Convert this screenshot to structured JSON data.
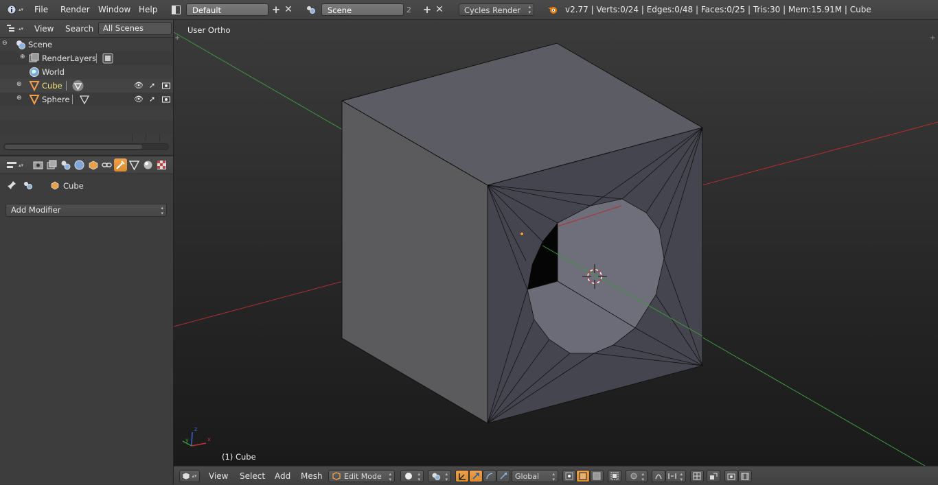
{
  "topbar": {
    "menus": [
      "File",
      "Render",
      "Window",
      "Help"
    ],
    "layout_name": "Default",
    "scene_name": "Scene",
    "scene_users": "2",
    "render_engine": "Cycles Render",
    "stats": "v2.77 | Verts:0/24 | Edges:0/48 | Faces:0/25 | Tris:30 | Mem:15.91M | Cube"
  },
  "outliner": {
    "header": {
      "view": "View",
      "search": "Search",
      "filter": "All Scenes"
    },
    "items": [
      {
        "label": "Scene"
      },
      {
        "label": "RenderLayers"
      },
      {
        "label": "World"
      },
      {
        "label": "Cube"
      },
      {
        "label": "Sphere"
      }
    ]
  },
  "properties": {
    "object_name": "Cube",
    "add_modifier": "Add Modifier"
  },
  "viewport": {
    "view_label": "User Ortho",
    "object_label": "(1) Cube",
    "axis_x": "x",
    "axis_y": "y",
    "axis_z": "z"
  },
  "bottombar": {
    "menus": [
      "View",
      "Select",
      "Add",
      "Mesh"
    ],
    "mode": "Edit Mode",
    "orientation": "Global"
  },
  "colors": {
    "accent": "#f0a04a",
    "selected_text": "#f3e27a",
    "axis_x": "#b52d2d",
    "axis_y": "#3c9a3c"
  }
}
